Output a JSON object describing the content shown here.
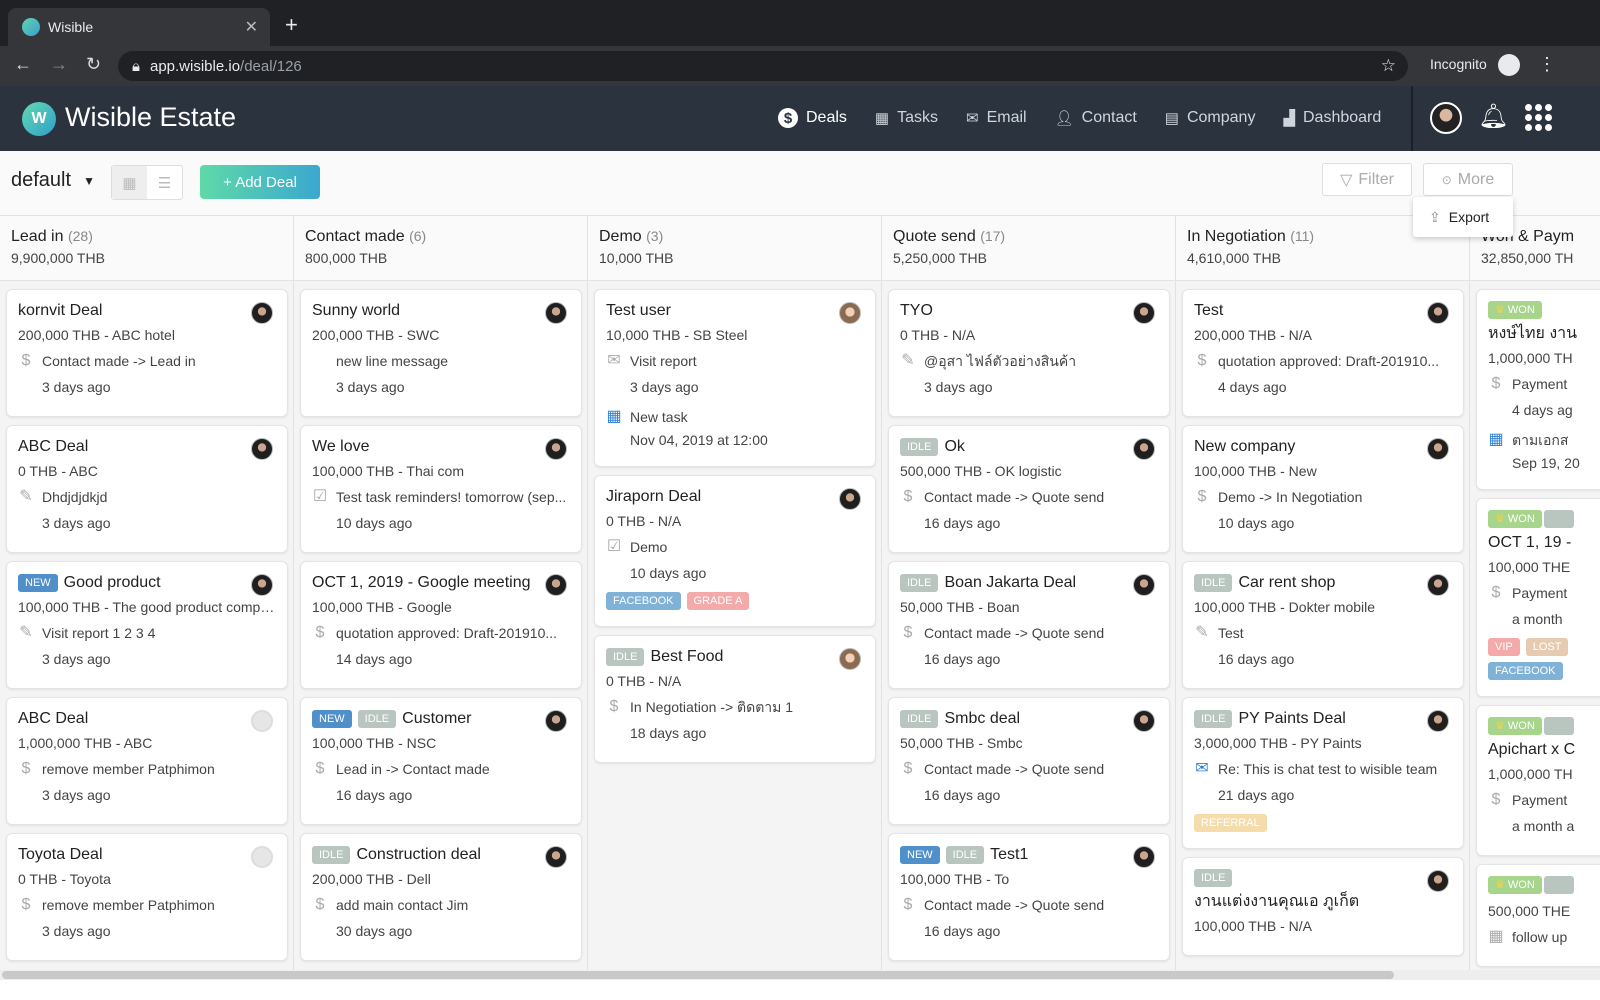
{
  "browser": {
    "tab_title": "Wisible",
    "url_host": "app.wisible.io",
    "url_path": "/deal/126",
    "incognito_label": "Incognito"
  },
  "app": {
    "brand": "Wisible Estate",
    "logo_text": "W",
    "nav": [
      {
        "label": "Deals",
        "icon": "dollar-circle-icon",
        "active": true
      },
      {
        "label": "Tasks",
        "icon": "calendar-icon"
      },
      {
        "label": "Email",
        "icon": "envelope-icon"
      },
      {
        "label": "Contact",
        "icon": "person-icon"
      },
      {
        "label": "Company",
        "icon": "building-icon"
      },
      {
        "label": "Dashboard",
        "icon": "bar-chart-icon"
      }
    ]
  },
  "toolbar": {
    "pipeline": "default",
    "add_deal": "+ Add Deal",
    "filter": "Filter",
    "more": "More",
    "export": "Export"
  },
  "colors": {
    "new": "#4f8fca",
    "idle": "#b9c6c0",
    "won": "#a6d58b",
    "facebook": "#7fb2d6",
    "grade_a": "#f3aaa8",
    "referral": "#f5dcab",
    "vip": "#f4aaa8",
    "lost": "#e7cbb0",
    "tag_gray": "#b9c6c0"
  },
  "columns": [
    {
      "title": "Lead in",
      "count": "(28)",
      "sum": "9,900,000 THB",
      "cards": [
        {
          "title": "kornvit Deal",
          "value": "200,000 THB - ABC hotel",
          "icon": "dollar",
          "activity": "Contact made -> Lead in",
          "time": "3 days ago"
        },
        {
          "title": "ABC Deal",
          "value": "0 THB - ABC",
          "icon": "edit",
          "activity": "Dhdjdjdkjd",
          "time": "3 days ago"
        },
        {
          "badges": [
            "NEW"
          ],
          "title": "Good product",
          "value": "100,000 THB - The good product compa...",
          "icon": "edit",
          "activity": "Visit report 1 2 3 4",
          "time": "3 days ago"
        },
        {
          "title": "ABC Deal",
          "value": "1,000,000 THB - ABC",
          "icon": "dollar",
          "activity": "remove member Patphimon",
          "time": "3 days ago",
          "avatar": "empty"
        },
        {
          "title": "Toyota Deal",
          "value": "0 THB - Toyota",
          "icon": "dollar",
          "activity": "remove member Patphimon",
          "time": "3 days ago",
          "avatar": "empty"
        }
      ]
    },
    {
      "title": "Contact made",
      "count": "(6)",
      "sum": "800,000 THB",
      "cards": [
        {
          "title": "Sunny world",
          "value": "200,000 THB - SWC",
          "icon": "none",
          "activity": "new line message",
          "time": "3 days ago"
        },
        {
          "title": "We love",
          "value": "100,000 THB - Thai com",
          "icon": "check",
          "activity": "Test task reminders! tomorrow (sep...",
          "time": "10 days ago"
        },
        {
          "title": "OCT 1, 2019 - Google meeting",
          "value": "100,000 THB - Google",
          "icon": "dollar",
          "activity": "quotation approved: Draft-201910...",
          "time": "14 days ago"
        },
        {
          "badges": [
            "NEW",
            "IDLE"
          ],
          "title": "Customer",
          "value": "100,000 THB - NSC",
          "icon": "dollar",
          "activity": "Lead in -> Contact made",
          "time": "16 days ago"
        },
        {
          "badges": [
            "IDLE"
          ],
          "title": "Construction deal",
          "value": "200,000 THB - Dell",
          "icon": "dollar",
          "activity": "add main contact Jim",
          "time": "30 days ago"
        }
      ]
    },
    {
      "title": "Demo",
      "count": "(3)",
      "sum": "10,000 THB",
      "cards": [
        {
          "title": "Test user",
          "value": "10,000 THB - SB Steel",
          "icon": "mail",
          "activity": "Visit report",
          "time": "3 days ago",
          "task": "New task",
          "task_date": "Nov 04, 2019 at 12:00",
          "avatar": "photo"
        },
        {
          "title": "Jiraporn Deal",
          "value": "0 THB - N/A",
          "icon": "check",
          "activity": "Demo",
          "time": "10 days ago",
          "tags": [
            "FACEBOOK",
            "GRADE A"
          ]
        },
        {
          "badges": [
            "IDLE"
          ],
          "title": "Best Food",
          "value": "0 THB - N/A",
          "icon": "dollar",
          "activity": "In Negotiation -> ติดตาม 1",
          "time": "18 days ago",
          "avatar": "photo"
        }
      ]
    },
    {
      "title": "Quote send",
      "count": "(17)",
      "sum": "5,250,000 THB",
      "cards": [
        {
          "title": "TYO",
          "value": "0 THB - N/A",
          "icon": "edit",
          "activity": "@อุสา ไฟล์ตัวอย่างสินค้า",
          "time": "3 days ago"
        },
        {
          "badges": [
            "IDLE"
          ],
          "title": "Ok",
          "value": "500,000 THB - OK logistic",
          "icon": "dollar",
          "activity": "Contact made -> Quote send",
          "time": "16 days ago"
        },
        {
          "badges": [
            "IDLE"
          ],
          "title": "Boan Jakarta Deal",
          "value": "50,000 THB - Boan",
          "icon": "dollar",
          "activity": "Contact made -> Quote send",
          "time": "16 days ago"
        },
        {
          "badges": [
            "IDLE"
          ],
          "title": "Smbc deal",
          "value": "50,000 THB - Smbc",
          "icon": "dollar",
          "activity": "Contact made -> Quote send",
          "time": "16 days ago"
        },
        {
          "badges": [
            "NEW",
            "IDLE"
          ],
          "title": "Test1",
          "value": "100,000 THB - To",
          "icon": "dollar",
          "activity": "Contact made -> Quote send",
          "time": "16 days ago"
        }
      ]
    },
    {
      "title": "In Negotiation",
      "count": "(11)",
      "sum": "4,610,000 THB",
      "cards": [
        {
          "title": "Test",
          "value": "200,000 THB - N/A",
          "icon": "dollar",
          "activity": "quotation approved: Draft-201910...",
          "time": "4 days ago"
        },
        {
          "title": "New company",
          "value": "100,000 THB - New",
          "icon": "dollar",
          "activity": "Demo -> In Negotiation",
          "time": "10 days ago"
        },
        {
          "badges": [
            "IDLE"
          ],
          "title": "Car rent shop",
          "value": "100,000 THB - Dokter mobile",
          "icon": "edit",
          "activity": "Test",
          "time": "16 days ago"
        },
        {
          "badges": [
            "IDLE"
          ],
          "title": "PY Paints Deal",
          "value": "3,000,000 THB - PY Paints",
          "icon": "bluemail",
          "activity": "Re: This is chat test to wisible team",
          "time": "21 days ago",
          "tags": [
            "REFERRAL"
          ]
        },
        {
          "badges": [
            "IDLE"
          ],
          "badge_own_line": true,
          "title": "งานแต่งงานคุณเอ ภูเก็ต",
          "value": "100,000 THB - N/A",
          "icon": "dollar",
          "activity": "",
          "time": ""
        }
      ]
    },
    {
      "title": "Won & Paym",
      "count": "",
      "sum": "32,850,000 TH",
      "cards": [
        {
          "badges": [
            "WON"
          ],
          "badge_own_line": true,
          "title": "หงษ์ไทย งาน",
          "value": "1,000,000 TH",
          "icon": "dollar",
          "activity": "Payment",
          "time": "4 days ag",
          "task": "ตามเอกส",
          "task_date": "Sep 19, 20",
          "noavatar": true
        },
        {
          "badges": [
            "WON",
            ""
          ],
          "badge_own_line": true,
          "title": "OCT 1, 19 -",
          "value": "100,000 THE",
          "icon": "dollar",
          "activity": "Payment",
          "time": "a month",
          "tags": [
            "VIP",
            "LOST"
          ],
          "tags2": [
            "FACEBOOK"
          ],
          "noavatar": true
        },
        {
          "badges": [
            "WON",
            ""
          ],
          "badge_own_line": true,
          "title": "Apichart x C",
          "value": "1,000,000 TH",
          "icon": "dollar",
          "activity": "Payment",
          "time": "a month a",
          "noavatar": true
        },
        {
          "badges": [
            "WON",
            ""
          ],
          "badge_own_line": true,
          "title": "",
          "value": "500,000 THE",
          "icon": "calendar",
          "activity": "follow up",
          "time": "",
          "noavatar": true
        }
      ]
    }
  ]
}
